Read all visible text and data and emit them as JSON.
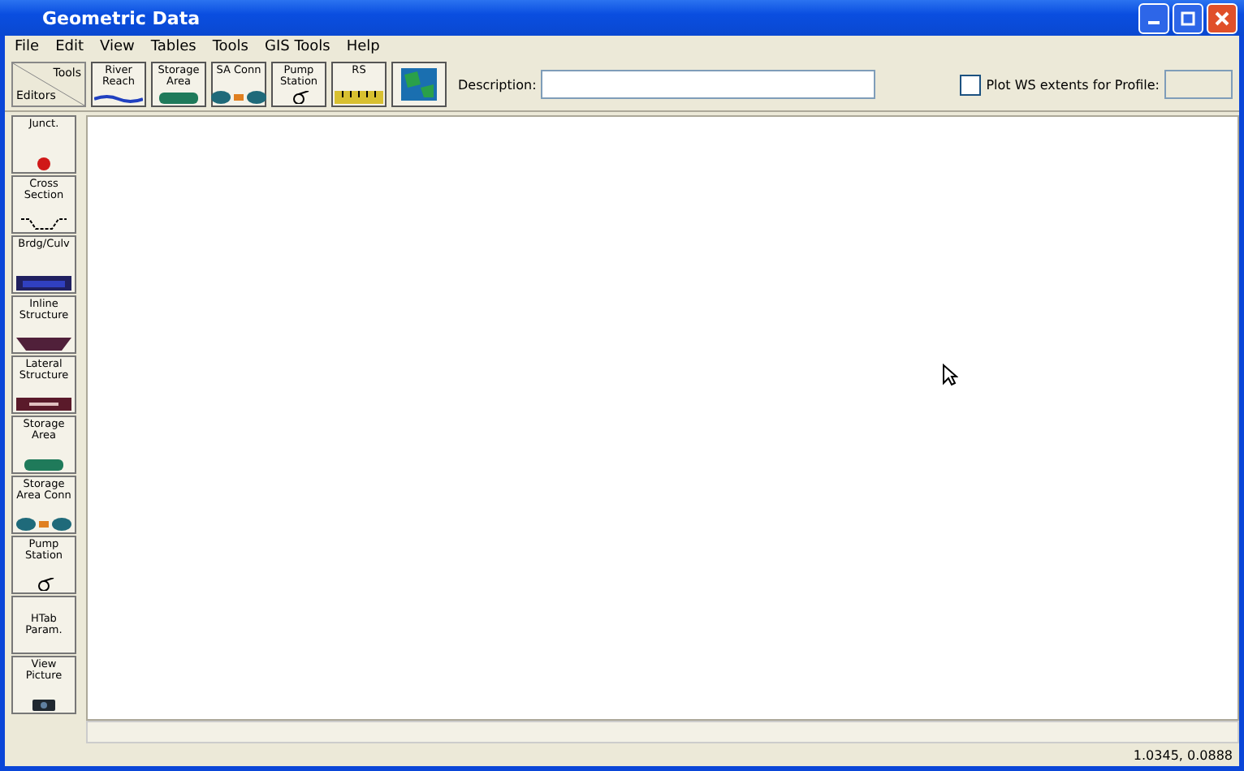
{
  "window": {
    "title": "Geometric Data"
  },
  "menu": [
    "File",
    "Edit",
    "View",
    "Tables",
    "Tools",
    "GIS Tools",
    "Help"
  ],
  "toolbar": {
    "editors": {
      "top": "Tools",
      "bottom": "Editors"
    },
    "buttons": [
      {
        "label": "River Reach",
        "kind": "reach"
      },
      {
        "label": "Storage Area",
        "kind": "storage"
      },
      {
        "label": "SA Conn",
        "kind": "conn"
      },
      {
        "label": "Pump Station",
        "kind": "pump"
      },
      {
        "label": "RS",
        "kind": "rs"
      },
      {
        "kind": "map"
      }
    ],
    "description_label": "Description:",
    "plot_ws": {
      "label": "Plot WS extents for Profile:",
      "checked": false
    }
  },
  "palette": [
    {
      "label": "Junct.",
      "kind": "dot"
    },
    {
      "label": "Cross Section",
      "kind": "xs"
    },
    {
      "label": "Brdg/Culv",
      "kind": "bridge"
    },
    {
      "label": "Inline Structure",
      "kind": "inline"
    },
    {
      "label": "Lateral Structure",
      "kind": "lateral"
    },
    {
      "label": "Storage Area",
      "kind": "storage"
    },
    {
      "label": "Storage Area Conn",
      "kind": "conn"
    },
    {
      "label": "Pump Station",
      "kind": "pump"
    },
    {
      "label": "HTab Param.",
      "kind": "none"
    },
    {
      "label": "View Picture",
      "kind": "picture"
    }
  ],
  "status_bar": {
    "coordinates": "1.0345, 0.0888"
  }
}
